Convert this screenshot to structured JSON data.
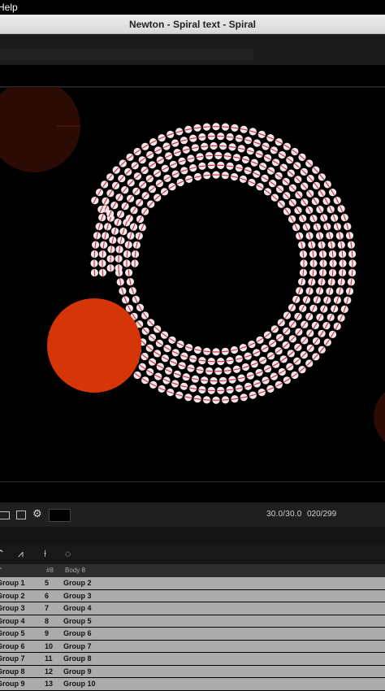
{
  "menubar": {
    "help_label": "Help"
  },
  "window": {
    "title": "Newton - Spiral text - Spiral"
  },
  "transport": {
    "rate": "30.0/30.0",
    "frame": "020/299"
  },
  "table": {
    "headers": {
      "col2": "#8",
      "col3": "Body 8"
    },
    "rows": [
      {
        "name": "Group 1",
        "index": "5",
        "body": "Group 2"
      },
      {
        "name": "Group 2",
        "index": "6",
        "body": "Group 3"
      },
      {
        "name": "Group 3",
        "index": "7",
        "body": "Group 4"
      },
      {
        "name": "Group 4",
        "index": "8",
        "body": "Group 5"
      },
      {
        "name": "Group 5",
        "index": "9",
        "body": "Group 6"
      },
      {
        "name": "Group 6",
        "index": "10",
        "body": "Group 7"
      },
      {
        "name": "Group 7",
        "index": "11",
        "body": "Group 8"
      },
      {
        "name": "Group 8",
        "index": "12",
        "body": "Group 9"
      },
      {
        "name": "Group 9",
        "index": "13",
        "body": "Group 10"
      }
    ]
  },
  "colors": {
    "orange_ball": "#d63508",
    "dark_ball": "#2c0b04",
    "bead_fill": "#f3e7ea",
    "bead_line": "#d1293e"
  },
  "icons": [
    "rect-icon",
    "rect-icon",
    "gear-icon",
    "waveform-icon",
    "pin-icon",
    "loop-icon"
  ]
}
